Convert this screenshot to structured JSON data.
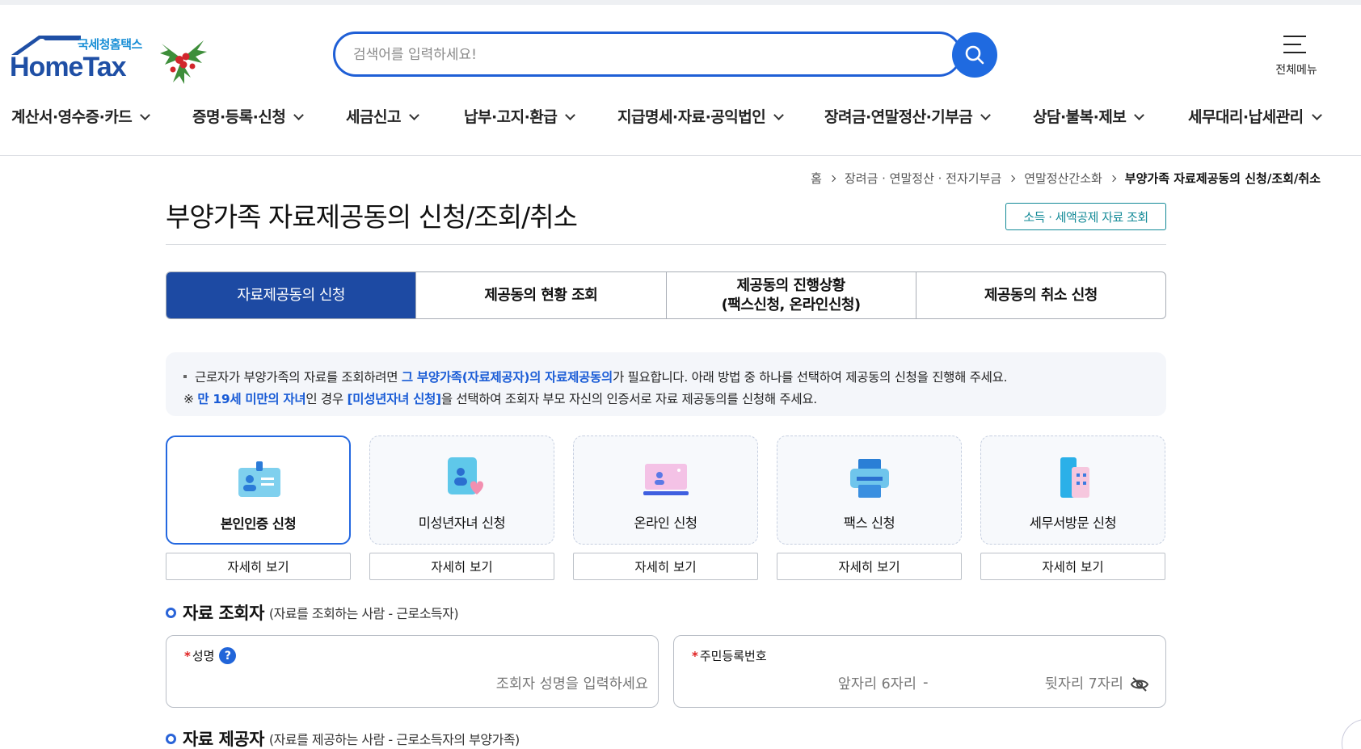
{
  "header": {
    "logo_ko": "국세청홈택스",
    "logo_en": "HomeTax",
    "search_placeholder": "검색어를 입력하세요!",
    "allmenu_label": "전체메뉴"
  },
  "gnb": [
    "계산서·영수증·카드",
    "증명·등록·신청",
    "세금신고",
    "납부·고지·환급",
    "지급명세·자료·공익법인",
    "장려금·연말정산·기부금",
    "상담·불복·제보",
    "세무대리·납세관리"
  ],
  "breadcrumb": {
    "home": "홈",
    "level1": "장려금 · 연말정산 · 전자기부금",
    "level2": "연말정산간소화",
    "current": "부양가족 자료제공동의 신청/조회/취소"
  },
  "page": {
    "title": "부양가족 자료제공동의 신청/조회/취소",
    "title_button": "소득 · 세액공제 자료 조회"
  },
  "tabs": [
    {
      "line1": "자료제공동의 신청",
      "line2": ""
    },
    {
      "line1": "제공동의 현황 조회",
      "line2": ""
    },
    {
      "line1": "제공동의 진행상황",
      "line2": "(팩스신청, 온라인신청)"
    },
    {
      "line1": "제공동의 취소 신청",
      "line2": ""
    }
  ],
  "info": {
    "l1_a": "근로자가 부양가족의 자료를 조회하려면 ",
    "l1_hl": "그 부양가족(자료제공자)의 자료제공동의",
    "l1_b": "가 필요합니다. 아래 방법 중 하나를 선택하여 제공동의 신청을 진행해 주세요.",
    "l2_prefix": "※ ",
    "l2_hl1": "만 19세 미만의 자녀",
    "l2_a": "인 경우 ",
    "l2_hl2": "[미성년자녀 신청]",
    "l2_b": "을 선택하여 조회자 부모 자신의 인증서로 자료 제공동의를 신청해 주세요."
  },
  "methods": [
    {
      "label": "본인인증 신청",
      "icon": "id-card-icon",
      "detail": "자세히 보기"
    },
    {
      "label": "미성년자녀 신청",
      "icon": "child-heart-icon",
      "detail": "자세히 보기"
    },
    {
      "label": "온라인 신청",
      "icon": "laptop-icon",
      "detail": "자세히 보기"
    },
    {
      "label": "팩스 신청",
      "icon": "fax-icon",
      "detail": "자세히 보기"
    },
    {
      "label": "세무서방문 신청",
      "icon": "building-icon",
      "detail": "자세히 보기"
    }
  ],
  "viewer_section": {
    "title": "자료 조회자",
    "subtitle": "(자료를 조회하는 사람 - 근로소득자)"
  },
  "fields": {
    "name_label": "성명",
    "name_required": "*",
    "name_help": "?",
    "name_placeholder": "조회자 성명을 입력하세요",
    "rrn_label": "주민등록번호",
    "rrn_required": "*",
    "rrn_front_placeholder": "앞자리 6자리",
    "rrn_dash": "-",
    "rrn_back_placeholder": "뒷자리 7자리"
  },
  "provider_section": {
    "title": "자료 제공자",
    "subtitle": "(자료를 제공하는 사람 - 근로소득자의 부양가족)"
  },
  "colors": {
    "primary": "#1d4aa3",
    "accent_blue": "#1a5cd6",
    "teal": "#138a97",
    "required": "#e02020"
  }
}
